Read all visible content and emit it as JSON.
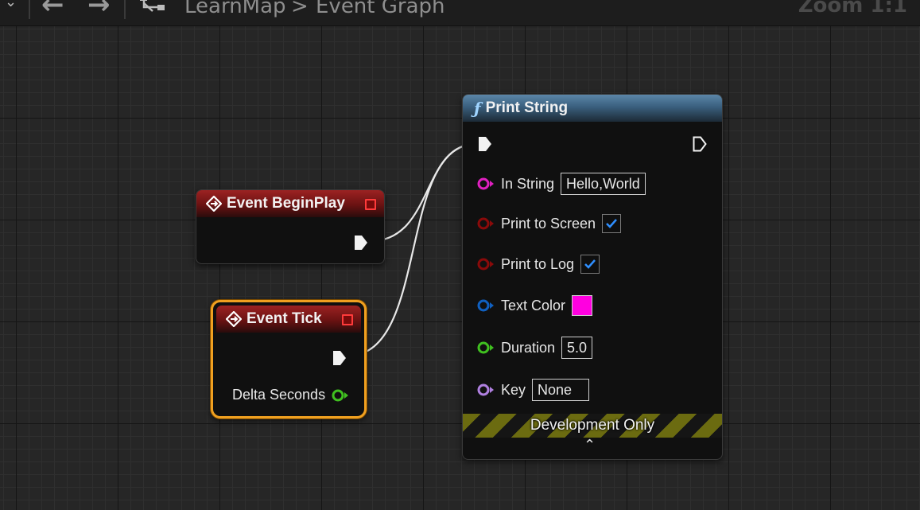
{
  "toolbar": {
    "back_icon": "arrow-left-icon",
    "forward_icon": "arrow-right-icon",
    "graph_icon": "graph-icon",
    "breadcrumb_root": "LearnMap",
    "breadcrumb_sep": ">",
    "breadcrumb_current": "Event Graph",
    "zoom_label": "Zoom 1:1"
  },
  "nodes": {
    "begin_play": {
      "title": "Event BeginPlay",
      "color": "#8a1a1a"
    },
    "tick": {
      "title": "Event Tick",
      "pin_delta": "Delta Seconds",
      "selected_color": "#f0a020"
    },
    "print_string": {
      "title": "Print String",
      "title_icon": "function-icon",
      "in_string_label": "In String",
      "in_string_value": "Hello,World",
      "print_to_screen_label": "Print to Screen",
      "print_to_screen": true,
      "print_to_log_label": "Print to Log",
      "print_to_log": true,
      "text_color_label": "Text Color",
      "text_color": "#ff00e0",
      "duration_label": "Duration",
      "duration_value": "5.0",
      "key_label": "Key",
      "key_value": "None",
      "dev_only_label": "Development Only",
      "collapse_icon": "chevron-up-icon"
    }
  },
  "pin_colors": {
    "string": "#e020c0",
    "bool": "#8a0a0a",
    "struct": "#1060c0",
    "float": "#40c020",
    "name": "#b080e0"
  }
}
